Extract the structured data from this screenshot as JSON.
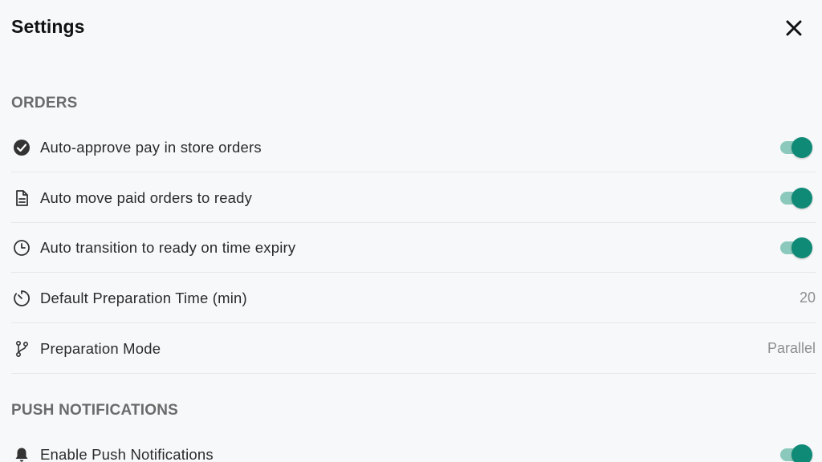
{
  "header": {
    "title": "Settings",
    "close_icon": "close-icon"
  },
  "sections": {
    "orders": {
      "title": "ORDERS",
      "items": [
        {
          "label": "Auto-approve pay in store orders",
          "icon": "check-circle-icon",
          "control": "toggle",
          "enabled": true
        },
        {
          "label": "Auto move paid orders to ready",
          "icon": "document-icon",
          "control": "toggle",
          "enabled": true
        },
        {
          "label": "Auto transition to ready on time expiry",
          "icon": "clock-icon",
          "control": "toggle",
          "enabled": true
        },
        {
          "label": "Default Preparation Time (min)",
          "icon": "timer-icon",
          "control": "value",
          "value": "20"
        },
        {
          "label": "Preparation Mode",
          "icon": "branch-icon",
          "control": "value",
          "value": "Parallel"
        }
      ]
    },
    "push": {
      "title": "PUSH NOTIFICATIONS",
      "items": [
        {
          "label": "Enable Push Notifications",
          "icon": "bell-icon",
          "control": "toggle",
          "enabled": true
        }
      ]
    }
  },
  "colors": {
    "accent": "#0e8a76",
    "accent_track": "#8cc9bd",
    "background": "#f7f8fa",
    "section_title": "#6b6b6b",
    "value_text": "#8f8f8f"
  }
}
